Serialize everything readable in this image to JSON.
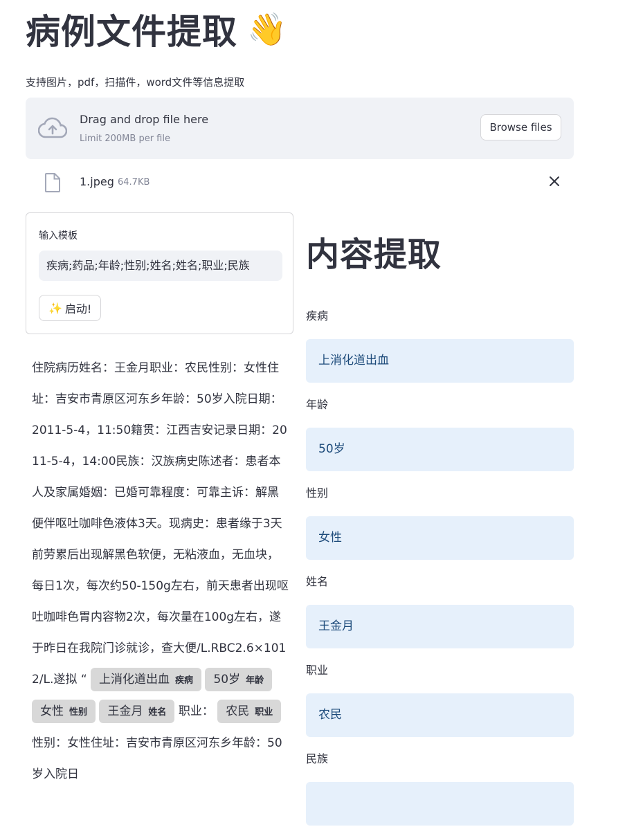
{
  "header": {
    "title": "病例文件提取",
    "title_emoji": "👋",
    "subtitle": "支持图片，pdf，扫描件，word文件等信息提取"
  },
  "uploader": {
    "drop_text": "Drag and drop file here",
    "limit_text": "Limit 200MB per file",
    "browse_label": "Browse files",
    "icon": "cloud-upload-icon"
  },
  "uploaded_file": {
    "name": "1.jpeg",
    "size": "64.7KB",
    "icon": "file-icon"
  },
  "form": {
    "label": "输入模板",
    "template_value": "疾病;药品;年龄;性别;姓名;姓名;职业;民族",
    "start_icon": "✨",
    "start_label": "启动!"
  },
  "document": {
    "plain_text": "住院病历姓名：王金月职业：农民性别：女性住址：吉安市青原区河东乡年龄：50岁入院日期：2011-5-4，11:50籍贯：江西吉安记录日期：2011-5-4，14:00民族：汉族病史陈述者：患者本人及家属婚姻：已婚可靠程度：可靠主诉：解黑便伴呕吐咖啡色液体3天。现病史：患者缘于3天前劳累后出现解黑色软便，无粘液血，无血块，每日1次，每次约50-150g左右，前天患者出现呕吐咖啡色胃内容物2次，每次量在100g左右，遂于昨日在我院门诊就诊，查大便/L.RBC2.6×1012/L.遂拟 “",
    "ent1_text": "上消化道出血",
    "ent1_label": "疾病",
    "ent2_text": "50岁",
    "ent2_label": "年龄",
    "ent3_text": "女性",
    "ent3_label": "性别",
    "ent4_text": "王金月",
    "ent4_label": "姓名",
    "seg_occupation": "职业：",
    "ent5_text": "农民",
    "ent5_label": "职业",
    "seg_tail": "性别：女性住址：吉安市青原区河东乡年龄：50岁入院日"
  },
  "extraction": {
    "title": "内容提取",
    "fields": [
      {
        "label": "疾病",
        "value": "上消化道出血"
      },
      {
        "label": "年龄",
        "value": "50岁"
      },
      {
        "label": "性别",
        "value": "女性"
      },
      {
        "label": "姓名",
        "value": "王金月"
      },
      {
        "label": "职业",
        "value": "农民"
      },
      {
        "label": "民族",
        "value": ""
      }
    ]
  },
  "colors": {
    "accent_field_bg": "#e6f0fb",
    "field_text": "#1c4a7a",
    "entity_highlight": "#d8d8d8",
    "uploader_bg": "#f0f2f6"
  }
}
